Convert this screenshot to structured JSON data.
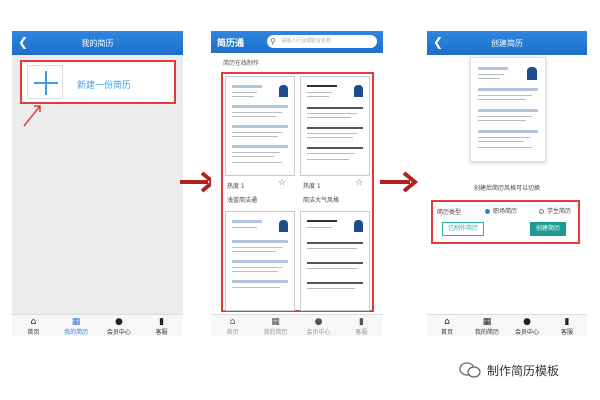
{
  "screen1": {
    "title": "我的简历",
    "new_resume_label": "新建一份简历",
    "tabs": [
      {
        "label": "首页",
        "icon": "home-icon"
      },
      {
        "label": "我的简历",
        "icon": "resume-icon"
      },
      {
        "label": "会员中心",
        "icon": "user-icon"
      },
      {
        "label": "客服",
        "icon": "chat-icon"
      }
    ]
  },
  "screen2": {
    "brand": "简历通",
    "search_placeholder": "请输入行业或职业名称",
    "section_title": "简历在线制作",
    "templates": [
      {
        "heat": "热度 1",
        "name": "浅蓝简洁通"
      },
      {
        "heat": "热度 1",
        "name": "简洁大气风格"
      }
    ],
    "tabs": [
      {
        "label": "首页",
        "icon": "home-icon"
      },
      {
        "label": "我的简历",
        "icon": "resume-icon"
      },
      {
        "label": "会员中心",
        "icon": "user-icon"
      },
      {
        "label": "客服",
        "icon": "chat-icon"
      }
    ]
  },
  "screen3": {
    "title": "创建简历",
    "hint": "创建后简历风格可以切换",
    "resume_type_label": "简历类型",
    "options": [
      "职场简历",
      "学生简历"
    ],
    "selected_option": "职场简历",
    "made_button": "已制作简历",
    "create_button": "创建简历",
    "tabs": [
      {
        "label": "首页",
        "icon": "home-icon"
      },
      {
        "label": "我的简历",
        "icon": "resume-icon"
      },
      {
        "label": "会员中心",
        "icon": "user-icon"
      },
      {
        "label": "客服",
        "icon": "chat-icon"
      }
    ]
  },
  "watermark": "制作简历模板",
  "colors": {
    "header_blue": "#1e6fca",
    "highlight_red": "#e03c3c",
    "accent_teal": "#1d9d92",
    "link_blue": "#3d9be9"
  }
}
